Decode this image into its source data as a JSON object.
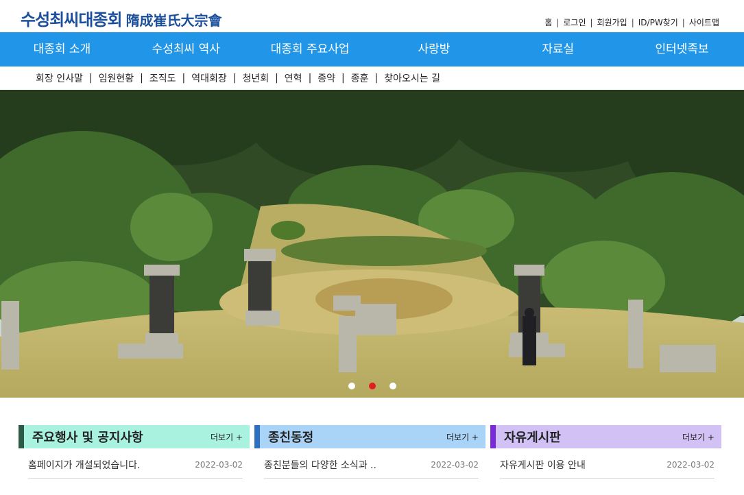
{
  "logo": {
    "korean": "수성최씨대종회",
    "hanja": "隋成崔氏大宗會"
  },
  "util_links": [
    "홈",
    "로그인",
    "회원가입",
    "ID/PW찾기",
    "사이트맵"
  ],
  "gnb": [
    "대종회 소개",
    "수성최씨 역사",
    "대종회 주요사업",
    "사랑방",
    "자료실",
    "인터넷족보"
  ],
  "lnb": [
    "회장 인사말",
    "임원현황",
    "조직도",
    "역대회장",
    "청년회",
    "연혁",
    "종약",
    "종훈",
    "찾아오시는 길"
  ],
  "slider": {
    "total": 3,
    "active_index": 2
  },
  "boards": [
    {
      "title": "주요행사 및 공지사항",
      "more": "더보기 +",
      "bg": "#a9f2e0",
      "bar": "#2d5a47",
      "posts": [
        {
          "title": "홈페이지가 개설되었습니다.",
          "date": "2022-03-02"
        }
      ]
    },
    {
      "title": "종친동정",
      "more": "더보기 +",
      "bg": "#a9d4f7",
      "bar": "#2f6fc0",
      "posts": [
        {
          "title": "종친분들의 다양한 소식과 ..",
          "date": "2022-03-02"
        }
      ]
    },
    {
      "title": "자유게시판",
      "more": "더보기 +",
      "bg": "#d2c1f5",
      "bar": "#7a2ad8",
      "posts": [
        {
          "title": "자유게시판 이용 안내",
          "date": "2022-03-02"
        }
      ]
    }
  ],
  "colors": {
    "gnb_bg": "#2196e8",
    "logo": "#1b4f9c",
    "active_dot": "#e02020"
  }
}
